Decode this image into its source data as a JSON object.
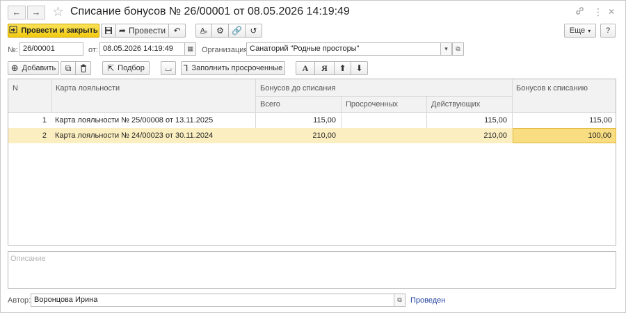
{
  "window": {
    "title": "Списание бонусов № 26/00001 от 08.05.2026 14:19:49",
    "back_icon": "←",
    "forward_icon": "→",
    "star_icon": "☆",
    "link_icon": "🔗",
    "more_icon": "⋮",
    "close_icon": "✕"
  },
  "toolbar": {
    "post_close_label": "Провести и закрыть",
    "post_label": "Провести",
    "more_label": "Еще",
    "help_label": "?"
  },
  "header": {
    "number_label": "№:",
    "number_value": "26/00001",
    "date_label": "от:",
    "date_value": "08.05.2026 14:19:49",
    "org_label": "Организация:",
    "org_value": "Санаторий \"Родные просторы\""
  },
  "table_toolbar": {
    "add_label": "Добавить",
    "select_label": "Подбор",
    "fill_overdue_label": "Заполнить просроченные",
    "sort_az": "А",
    "sort_za": "Я",
    "up": "⬆",
    "down": "⬇"
  },
  "table": {
    "col_n": "N",
    "col_card": "Карта лояльности",
    "col_group_before": "Бонусов до списания",
    "col_total": "Всего",
    "col_overdue": "Просроченных",
    "col_active": "Действующих",
    "col_to_write_off": "Бонусов к списанию",
    "rows": [
      {
        "n": "1",
        "card": "Карта лояльности № 25/00008 от 13.11.2025",
        "total": "115,00",
        "overdue": "",
        "active": "115,00",
        "write_off": "115,00"
      },
      {
        "n": "2",
        "card": "Карта лояльности № 24/00023 от 30.11.2024",
        "total": "210,00",
        "overdue": "",
        "active": "210,00",
        "write_off": "100,00"
      }
    ]
  },
  "description": {
    "placeholder": "Описание"
  },
  "footer": {
    "author_label": "Автор:",
    "author_value": "Воронцова Ирина",
    "status": "Проведен"
  }
}
